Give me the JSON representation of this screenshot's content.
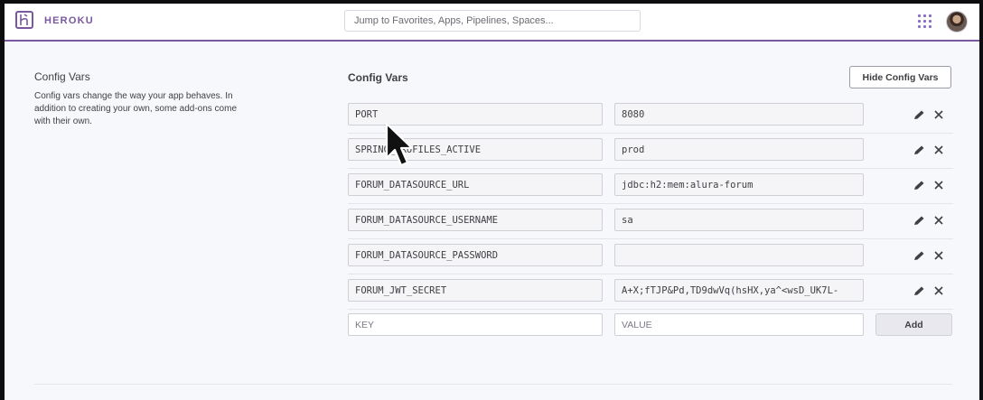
{
  "header": {
    "brand": "HEROKU",
    "search_placeholder": "Jump to Favorites, Apps, Pipelines, Spaces..."
  },
  "section": {
    "title": "Config Vars",
    "description": "Config vars change the way your app behaves. In addition to creating your own, some add-ons come with their own."
  },
  "panel": {
    "title": "Config Vars",
    "hide_label": "Hide Config Vars"
  },
  "config_vars": [
    {
      "key": "PORT",
      "value": "8080"
    },
    {
      "key": "SPRING_PROFILES_ACTIVE",
      "value": "prod"
    },
    {
      "key": "FORUM_DATASOURCE_URL",
      "value": "jdbc:h2:mem:alura-forum"
    },
    {
      "key": "FORUM_DATASOURCE_USERNAME",
      "value": "sa"
    },
    {
      "key": "FORUM_DATASOURCE_PASSWORD",
      "value": ""
    },
    {
      "key": "FORUM_JWT_SECRET",
      "value": "A+X;fTJP&Pd,TD9dwVq(hsHX,ya^<wsD_UK7L-"
    }
  ],
  "new_var": {
    "key_placeholder": "KEY",
    "value_placeholder": "VALUE",
    "add_label": "Add"
  },
  "colors": {
    "accent": "#79589f",
    "apps_grid": "#8c6bc4"
  },
  "icons": {
    "logo": "heroku-logo-icon",
    "apps": "apps-grid-icon",
    "edit": "pencil-icon",
    "delete": "close-icon",
    "pointer": "mouse-cursor-icon"
  }
}
